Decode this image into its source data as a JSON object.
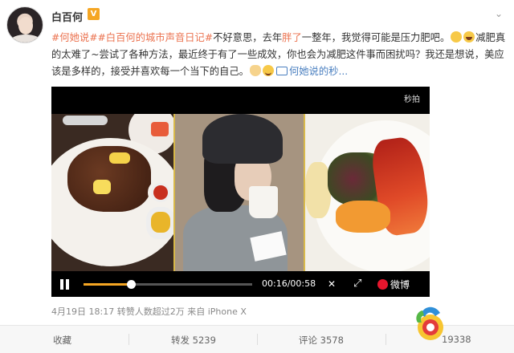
{
  "user": {
    "name": "白百何",
    "verified_badge": "V",
    "more_icon": "chevron-down"
  },
  "post": {
    "hashtag1": "#何她说#",
    "hashtag2": "#白百何的城市声音日记#",
    "text_a": "不好意思，去年",
    "text_highlight": "胖了",
    "text_b": "一整年，我觉得可能是压力肥吧。",
    "text_c": "减肥真的太难了~尝试了各种方法，最近终于有了一些成效，你也会为减肥这件事而困扰吗？我还是想说，美应该是多样的，接受并喜欢每一个当下的自己。",
    "video_link": "何她说的秒..."
  },
  "video": {
    "watermark": "秒拍",
    "time": "00:16/00:58",
    "progress": 0.28,
    "brand": "微博",
    "icons": [
      "pause-icon",
      "mute-icon",
      "fullscreen-icon",
      "weibo-logo-icon"
    ]
  },
  "meta": {
    "date": "4月19日 18:17",
    "reposts_note": "转赞人数超过2万",
    "from_label": "来自",
    "device": "iPhone X"
  },
  "actions": {
    "favorite": "收藏",
    "repost": "转发 5239",
    "comment": "评论 3578",
    "like": "19338"
  },
  "colors": {
    "link": "#eb7350",
    "accent": "#f5a623"
  }
}
